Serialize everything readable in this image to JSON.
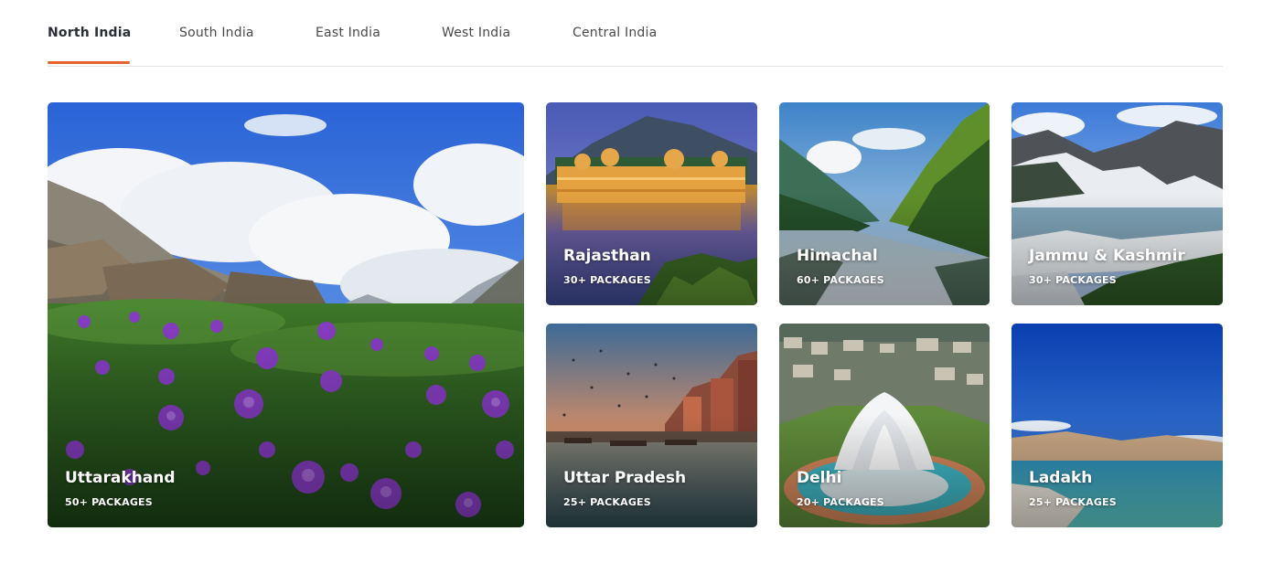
{
  "tabs": [
    {
      "label": "North India",
      "active": true
    },
    {
      "label": "South India",
      "active": false
    },
    {
      "label": "East India",
      "active": false
    },
    {
      "label": "West India",
      "active": false
    },
    {
      "label": "Central India",
      "active": false
    }
  ],
  "accent_color": "#e8622c",
  "destinations": [
    {
      "name": "Uttarakhand",
      "packages": "50+ PACKAGES"
    },
    {
      "name": "Rajasthan",
      "packages": "30+ PACKAGES"
    },
    {
      "name": "Himachal",
      "packages": "60+ PACKAGES"
    },
    {
      "name": "Jammu & Kashmir",
      "packages": "30+ PACKAGES"
    },
    {
      "name": "Uttar Pradesh",
      "packages": "25+ PACKAGES"
    },
    {
      "name": "Delhi",
      "packages": "20+ PACKAGES"
    },
    {
      "name": "Ladakh",
      "packages": "25+ PACKAGES"
    }
  ]
}
